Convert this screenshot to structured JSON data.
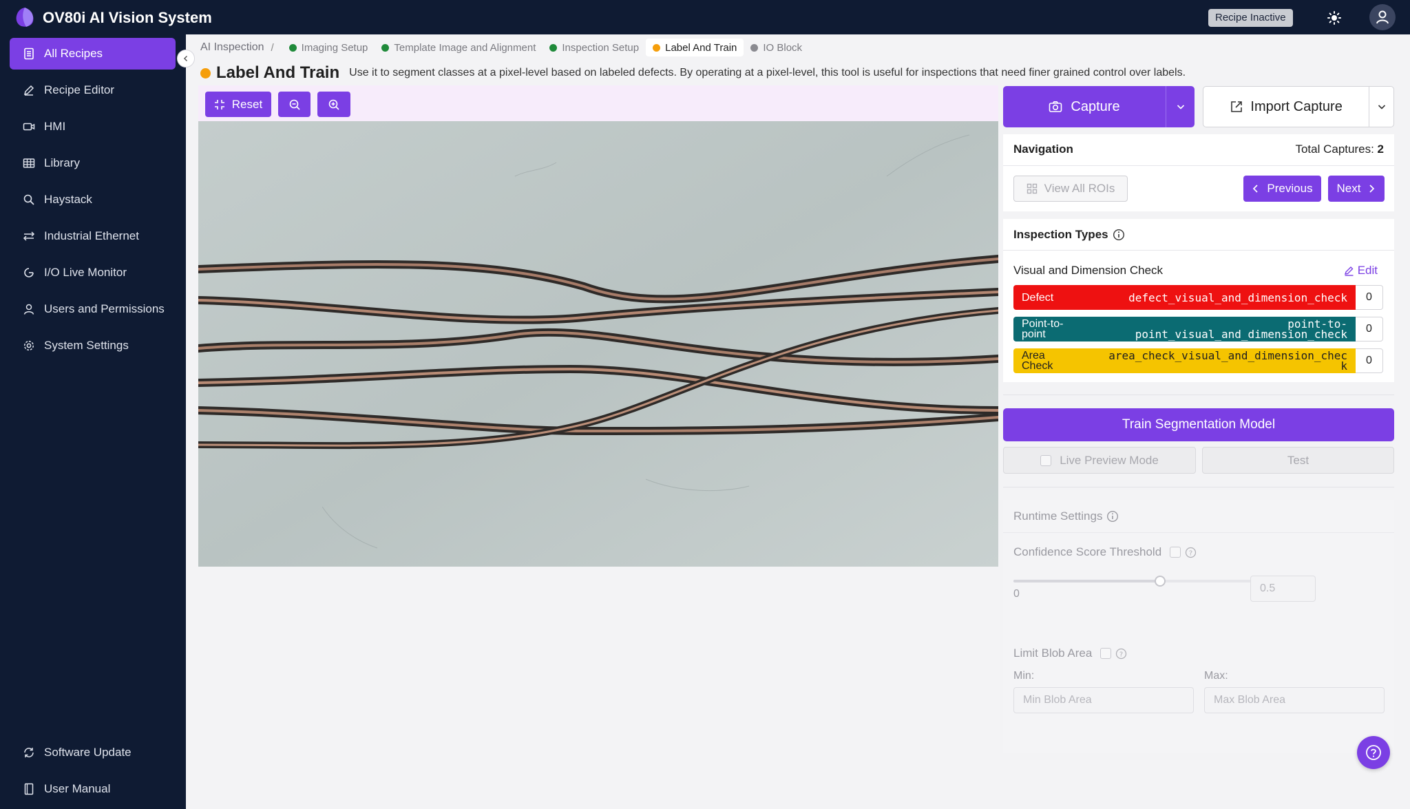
{
  "app": {
    "title": "OV80i AI Vision System",
    "recipe_status": "Recipe Inactive"
  },
  "sidebar": {
    "items": [
      {
        "label": "All Recipes",
        "icon": "document-icon",
        "active": true
      },
      {
        "label": "Recipe Editor",
        "icon": "pen-icon"
      },
      {
        "label": "HMI",
        "icon": "video-icon"
      },
      {
        "label": "Library",
        "icon": "grid-icon"
      },
      {
        "label": "Haystack",
        "icon": "search-icon"
      },
      {
        "label": "Industrial Ethernet",
        "icon": "network-icon"
      },
      {
        "label": "I/O Live Monitor",
        "icon": "monitor-icon"
      },
      {
        "label": "Users and Permissions",
        "icon": "user-icon"
      },
      {
        "label": "System Settings",
        "icon": "gear-icon"
      }
    ],
    "bottom": [
      {
        "label": "Software Update",
        "icon": "refresh-icon"
      },
      {
        "label": "User Manual",
        "icon": "book-icon"
      }
    ]
  },
  "breadcrumb": {
    "root": "AI Inspection",
    "separator": "/",
    "steps": [
      {
        "label": "Imaging Setup",
        "color": "#1f8a3a"
      },
      {
        "label": "Template Image and Alignment",
        "color": "#1f8a3a"
      },
      {
        "label": "Inspection Setup",
        "color": "#1f8a3a"
      },
      {
        "label": "Label And Train",
        "color": "#f59e0b",
        "active": true
      },
      {
        "label": "IO Block",
        "color": "#8a8a90"
      }
    ]
  },
  "page": {
    "title": "Label And Train",
    "description": "Use it to segment classes at a pixel-level based on labeled defects. By operating at a pixel-level, this tool is useful for inspections that need finer grained control over labels."
  },
  "toolbar": {
    "reset_label": "Reset"
  },
  "capture": {
    "capture_label": "Capture",
    "import_label": "Import Capture"
  },
  "navigation": {
    "heading": "Navigation",
    "total_label": "Total Captures:",
    "total_value": "2",
    "view_all_label": "View All ROIs",
    "previous_label": "Previous",
    "next_label": "Next"
  },
  "inspection_types": {
    "heading": "Inspection Types",
    "group_label": "Visual and Dimension Check",
    "edit_label": "Edit",
    "types": [
      {
        "name": "Defect",
        "code": "defect_visual_and_dimension_check",
        "count": "0",
        "color": "#ee1111",
        "text_color": "#ffffff"
      },
      {
        "name_line1": "Point-to-",
        "name_line2": "point",
        "code_line1": "point-to-",
        "code_line2": "point_visual_and_dimension_check",
        "count": "0",
        "color": "#0b6b72",
        "text_color": "#ffffff"
      },
      {
        "name_line1": "Area",
        "name_line2": "Check",
        "code_line1": "area_check_visual_and_dimension_chec",
        "code_line2": "k",
        "count": "0",
        "color": "#f5c400",
        "text_color": "#1f1f1f"
      }
    ]
  },
  "train": {
    "label": "Train Segmentation Model",
    "live_preview_label": "Live Preview Mode",
    "test_label": "Test"
  },
  "runtime": {
    "heading": "Runtime Settings",
    "confidence_label": "Confidence Score Threshold",
    "slider_min": "0",
    "slider_max": "1",
    "slider_value": "0.5",
    "limit_blob_label": "Limit Blob Area",
    "min_label": "Min:",
    "max_label": "Max:",
    "min_placeholder": "Min Blob Area",
    "max_placeholder": "Max Blob Area"
  }
}
